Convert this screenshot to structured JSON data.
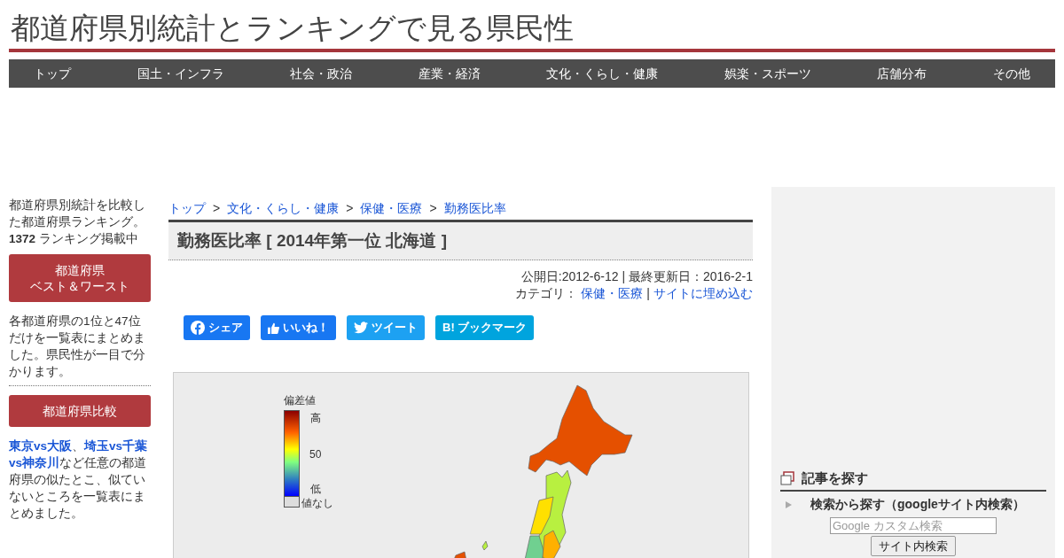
{
  "site_title": "都道府県別統計とランキングで見る県民性",
  "nav": [
    "トップ",
    "国土・インフラ",
    "社会・政治",
    "産業・経済",
    "文化・くらし・健康",
    "娯楽・スポーツ",
    "店舗分布",
    "その他"
  ],
  "sidebar": {
    "intro": "都道府県別統計を比較した都道府県ランキング。**1372** ランキング掲載中",
    "best_worst_button": [
      "都道府県",
      "ベスト＆ワースト"
    ],
    "best_worst_text": "各都道府県の1位と47位だけを一覧表にまとめました。県民性が一目で分かります。",
    "compare_button": "都道府県比較",
    "compare_text": [
      {
        "kind": "link",
        "text": "東京vs大阪"
      },
      {
        "kind": "text",
        "text": "、"
      },
      {
        "kind": "link",
        "text": "埼玉vs千葉"
      },
      {
        "kind": "link",
        "text": "vs神奈川"
      },
      {
        "kind": "text",
        "text": "など任意の都道府県の似たとこ、似ていないところを一覧表にまとめました。"
      }
    ]
  },
  "breadcrumbs": [
    "トップ",
    "文化・くらし・健康",
    "保健・医療",
    "勤務医比率"
  ],
  "breadcrumb_separator": ">",
  "article_title": "勤務医比率 [ 2014年第一位 北海道 ]",
  "meta": {
    "dates": "公開日:2012-6-12 | 最終更新日：2016-2-1",
    "category_label": "カテゴリ：",
    "category_link": "保健・医療",
    "separator": "|",
    "embed_link": "サイトに埋め込む"
  },
  "share_buttons": [
    {
      "kind": "facebook",
      "label": "シェア"
    },
    {
      "kind": "like",
      "label": "いいね！"
    },
    {
      "kind": "twitter",
      "label": "ツイート"
    },
    {
      "kind": "hatena",
      "label": "B! ブックマーク"
    }
  ],
  "map_legend": {
    "title": "偏差値",
    "high": "高",
    "mid": "50",
    "low": "低",
    "none": "値なし"
  },
  "right_panel": {
    "heading": "記事を探す",
    "search_heading": "検索から探す（googleサイト内検索）",
    "search_placeholder": "Google カスタム検索",
    "search_button": "サイト内検索"
  }
}
